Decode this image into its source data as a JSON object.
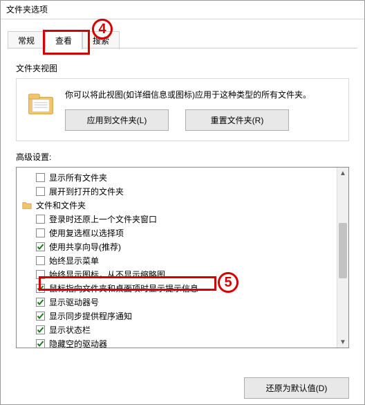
{
  "window_title": "文件夹选项",
  "tabs": {
    "general": "常规",
    "view": "查看",
    "search": "搜索"
  },
  "folder_view": {
    "heading": "文件夹视图",
    "description": "你可以将此视图(如详细信息或图标)应用于这种类型的所有文件夹。",
    "apply_btn": "应用到文件夹(L)",
    "reset_btn": "重置文件夹(R)"
  },
  "advanced_label": "高级设置:",
  "tree": [
    {
      "label": "显示所有文件夹",
      "checked": false,
      "indent": true,
      "type": "checkbox"
    },
    {
      "label": "展开到打开的文件夹",
      "checked": false,
      "indent": true,
      "type": "checkbox"
    },
    {
      "label": "文件和文件夹",
      "checked": null,
      "indent": false,
      "type": "folder"
    },
    {
      "label": "登录时还原上一个文件夹窗口",
      "checked": false,
      "indent": true,
      "type": "checkbox"
    },
    {
      "label": "使用复选框以选择项",
      "checked": false,
      "indent": true,
      "type": "checkbox"
    },
    {
      "label": "使用共享向导(推荐)",
      "checked": true,
      "indent": true,
      "type": "checkbox"
    },
    {
      "label": "始终显示菜单",
      "checked": false,
      "indent": true,
      "type": "checkbox"
    },
    {
      "label": "始终显示图标，从不显示缩略图",
      "checked": false,
      "indent": true,
      "type": "checkbox",
      "highlight": true
    },
    {
      "label": "鼠标指向文件夹和桌面项时显示提示信息",
      "checked": true,
      "indent": true,
      "type": "checkbox"
    },
    {
      "label": "显示驱动器号",
      "checked": true,
      "indent": true,
      "type": "checkbox"
    },
    {
      "label": "显示同步提供程序通知",
      "checked": true,
      "indent": true,
      "type": "checkbox"
    },
    {
      "label": "显示状态栏",
      "checked": true,
      "indent": true,
      "type": "checkbox"
    },
    {
      "label": "隐藏空的驱动器",
      "checked": true,
      "indent": true,
      "type": "checkbox"
    }
  ],
  "restore_defaults_btn": "还原为默认值(D)",
  "annotations": {
    "callout_4": "4",
    "callout_5": "5"
  }
}
